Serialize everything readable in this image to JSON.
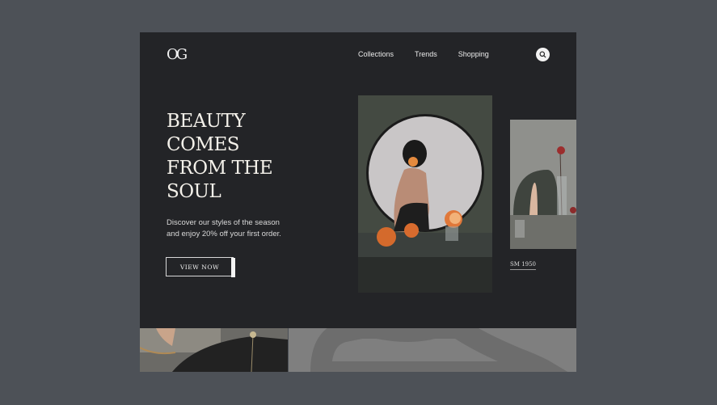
{
  "brand": {
    "logo_text": "OG"
  },
  "nav": {
    "items": [
      "Collections",
      "Trends",
      "Shopping"
    ]
  },
  "hero": {
    "headline_lines": [
      "BEAUTY",
      "COMES",
      "FROM THE",
      "SOUL"
    ],
    "subtitle_line1": "Discover our styles of the season",
    "subtitle_line2": "and enjoy 20% off your first order.",
    "cta_label": "VIEW NOW"
  },
  "side_photo": {
    "caption": "SM 1950"
  },
  "icons": {
    "search": "search-icon"
  },
  "colors": {
    "page_bg": "#4d5157",
    "card_bg": "#232427",
    "text_light": "#f4f1ea",
    "accent_orange": "#e0783a"
  }
}
